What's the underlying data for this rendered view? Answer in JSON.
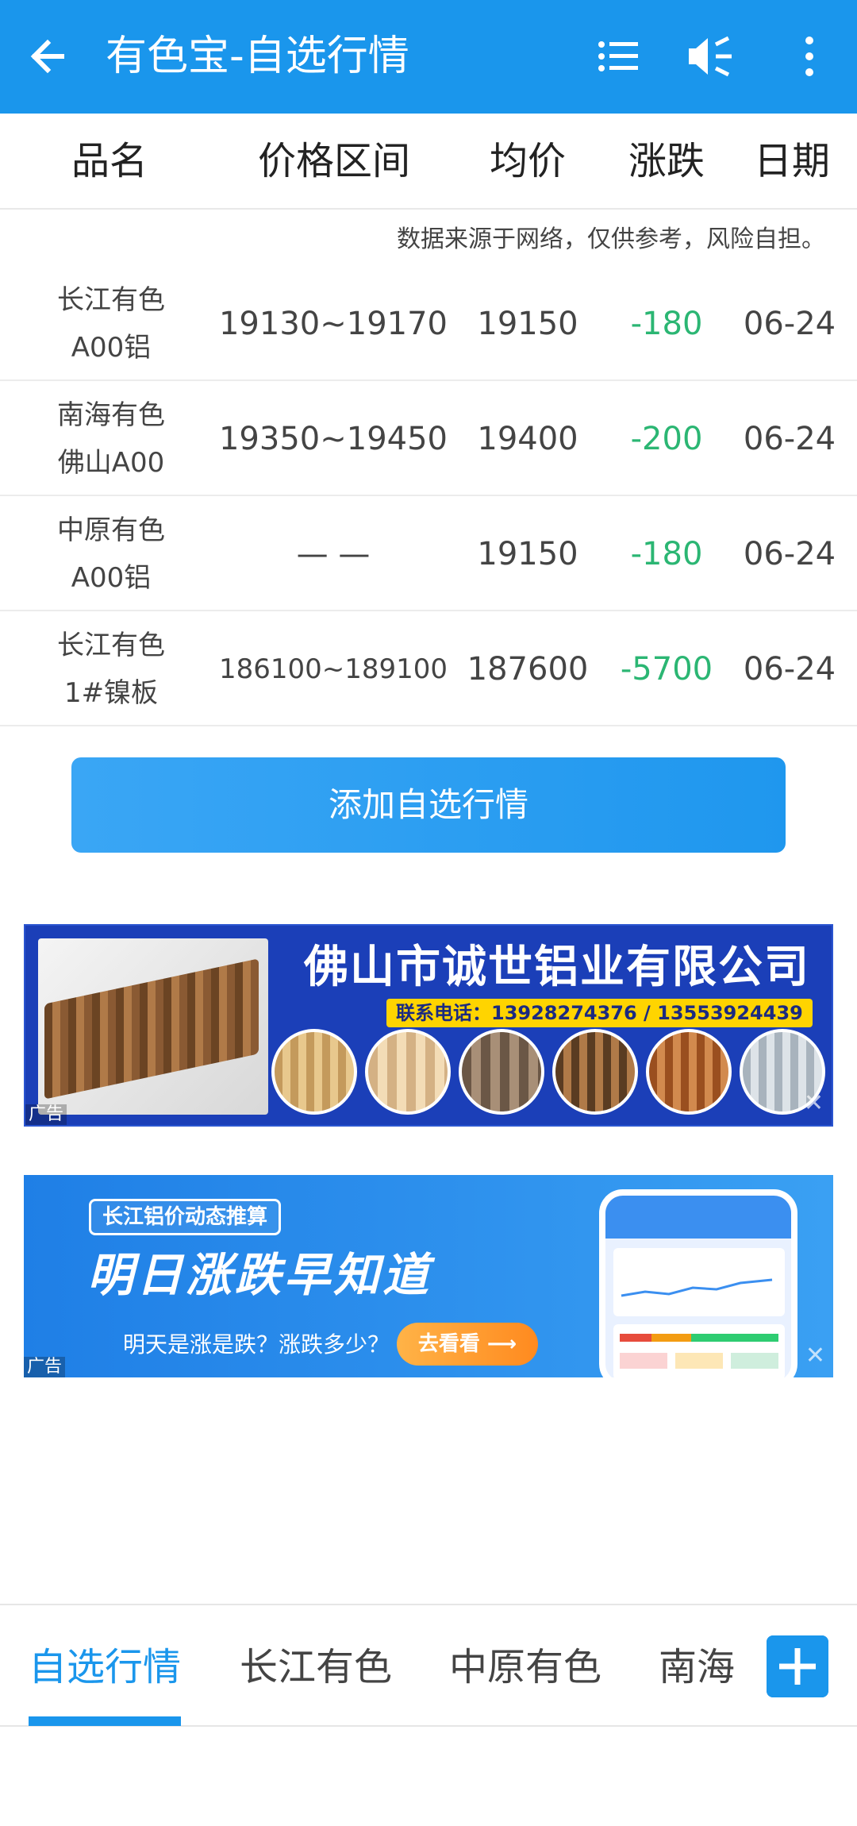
{
  "appbar": {
    "title": "有色宝-自选行情",
    "icons": [
      "back-arrow-icon",
      "list-icon",
      "mute-icon",
      "more-vertical-icon"
    ]
  },
  "table": {
    "headers": [
      "品名",
      "价格区间",
      "均价",
      "涨跌",
      "日期"
    ],
    "notice": "数据来源于网络，仅供参考，风险自担。",
    "rows": [
      {
        "name1": "长江有色",
        "name2": "A00铝",
        "range": "19130~19170",
        "avg": "19150",
        "change": "-180",
        "date": "06-24"
      },
      {
        "name1": "南海有色",
        "name2": "佛山A00",
        "range": "19350~19450",
        "avg": "19400",
        "change": "-200",
        "date": "06-24"
      },
      {
        "name1": "中原有色",
        "name2": "A00铝",
        "range": "— —",
        "avg": "19150",
        "change": "-180",
        "date": "06-24"
      },
      {
        "name1": "长江有色",
        "name2": "1#镍板",
        "range": "186100~189100",
        "avg": "187600",
        "change": "-5700",
        "date": "06-24"
      }
    ],
    "change_color": "#2bb673"
  },
  "add_button": {
    "label": "添加自选行情"
  },
  "ads": {
    "label": "广告",
    "close": "✕",
    "ad1": {
      "headline": "佛山市诚世铝业有限公司",
      "phone": "联系电话：13928274376 / 13553924439"
    },
    "ad2": {
      "tag": "长江铝价动态推算",
      "headline": "明日涨跌早知道",
      "sub": "明天是涨是跌？涨跌多少？",
      "button": "去看看 ⟶"
    }
  },
  "tabs": {
    "items": [
      "自选行情",
      "长江有色",
      "中原有色",
      "南海"
    ],
    "active": 0
  },
  "colors": {
    "accent": "#1a96ec"
  }
}
